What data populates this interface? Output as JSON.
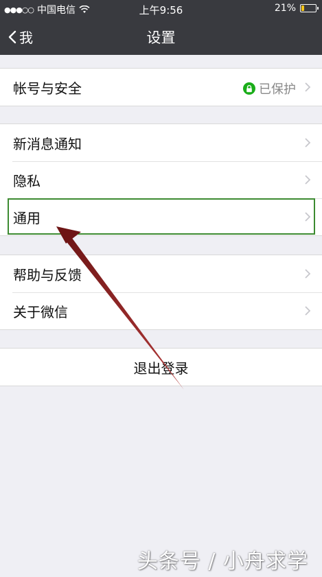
{
  "status_bar": {
    "carrier": "中国电信",
    "time": "上午9:56",
    "battery": "21%",
    "battery_level": 0.21,
    "signal_icon": "signal-dots-icon",
    "wifi_icon": "wifi-icon"
  },
  "nav": {
    "back_label": "我",
    "title": "设置"
  },
  "groups": {
    "account": {
      "label": "帐号与安全",
      "status": "已保护"
    },
    "notifications": [
      {
        "label": "新消息通知"
      },
      {
        "label": "隐私"
      },
      {
        "label": "通用"
      }
    ],
    "help": [
      {
        "label": "帮助与反馈"
      },
      {
        "label": "关于微信"
      }
    ]
  },
  "logout_label": "退出登录",
  "watermark": "头条号 / 小舟求学",
  "colors": {
    "nav_bg": "#393a3f",
    "page_bg": "#efeff4",
    "protect_green": "#1aad19",
    "highlight_border": "#3c8a30",
    "arrow": "#7a1a1a"
  }
}
